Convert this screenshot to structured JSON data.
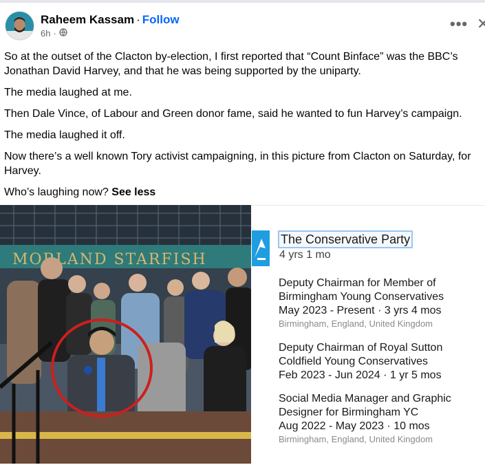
{
  "post": {
    "author": "Raheem Kassam",
    "separator": "·",
    "follow_label": "Follow",
    "time": "6h",
    "time_separator": "·",
    "more_icon": "more-horizontal-icon",
    "close_icon": "close-icon",
    "paragraphs": [
      "So at the outset of the Clacton by-election, I first reported that “Count Binface” was the BBC’s Jonathan David Harvey, and that he was being supported by the uniparty.",
      "The media laughed at me.",
      "Then Dale Vince, of Labour and Green donor fame, said he wanted to fun Harvey’s campaign.",
      "The media laughed it off.",
      "Now there’s a well known Tory activist campaigning, in this picture from Clacton on Saturday, for Harvey."
    ],
    "last_line": "Who’s laughing now?",
    "see_less_label": "See less"
  },
  "photo": {
    "shop_sign": "MORLAND STARFISH",
    "highlight_color": "#cc1f1f"
  },
  "linkedin": {
    "company": "The Conservative Party",
    "duration": "4 yrs 1 mo",
    "roles": [
      {
        "title_line1": "Deputy Chairman for Member of",
        "title_line2": "Birmingham Young Conservatives",
        "dates": "May 2023 - Present  ·  3 yrs 4 mos",
        "location": "Birmingham, England, United Kingdom"
      },
      {
        "title_line1": "Deputy Chairman of Royal Sutton",
        "title_line2": "Coldfield Young Conservatives",
        "dates": "Feb 2023 - Jun 2024  ·  1 yr 5 mos",
        "location": ""
      },
      {
        "title_line1": "Social Media Manager and Graphic",
        "title_line2": "Designer for Birmingham YC",
        "dates": "Aug 2022 - May 2023  ·  10 mos",
        "location": "Birmingham, England, United Kingdom"
      }
    ]
  },
  "colors": {
    "facebook_blue": "#0866ff",
    "conservative_blue": "#1e9ee1",
    "circle_red": "#cc1f1f"
  }
}
